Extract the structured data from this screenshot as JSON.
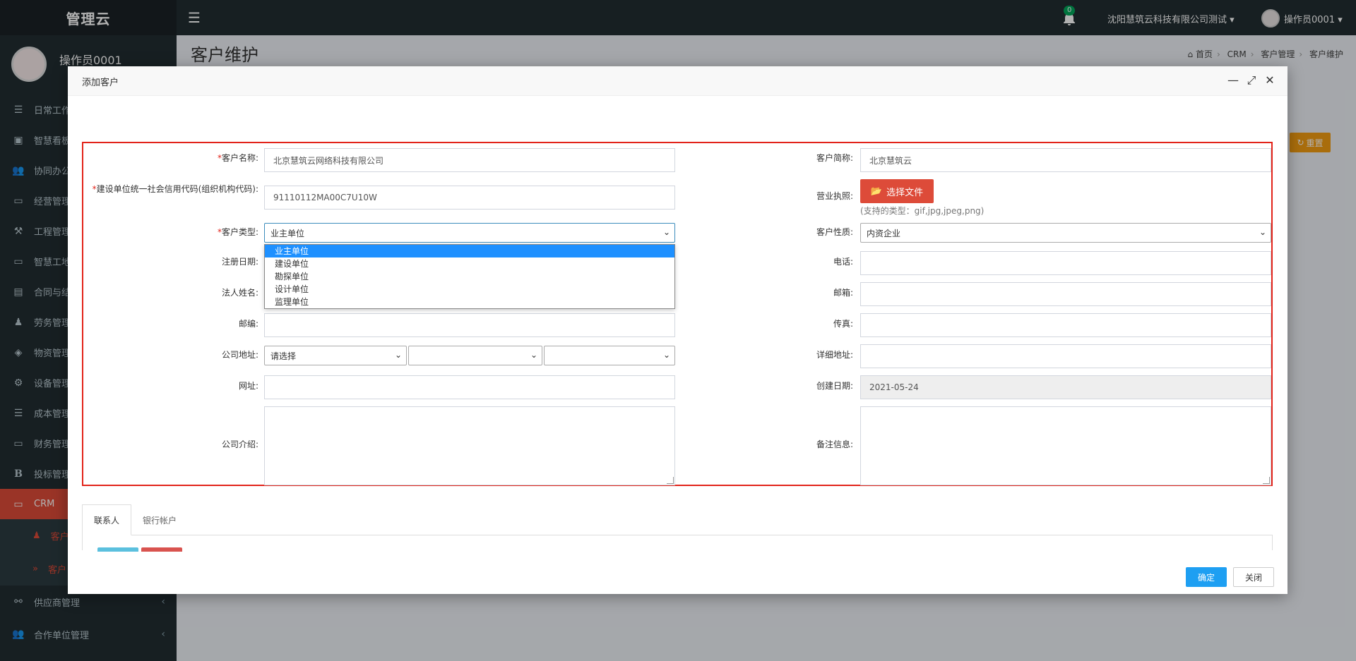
{
  "app": {
    "logo": "管理云",
    "notif_count": "0",
    "company": "沈阳慧筑云科技有限公司测试",
    "user": "操作员0001"
  },
  "sidebar": {
    "user_name": "操作员0001",
    "items": [
      {
        "label": "日常工作",
        "icon": "list-icon"
      },
      {
        "label": "智慧看板",
        "icon": "dashboard-icon"
      },
      {
        "label": "协同办公",
        "icon": "users-icon"
      },
      {
        "label": "经营管理",
        "icon": "monitor-icon"
      },
      {
        "label": "工程管理",
        "icon": "hammer-icon"
      },
      {
        "label": "智慧工地",
        "icon": "monitor-icon"
      },
      {
        "label": "合同与结算",
        "icon": "file-icon"
      },
      {
        "label": "劳务管理",
        "icon": "worker-icon"
      },
      {
        "label": "物资管理",
        "icon": "cube-icon"
      },
      {
        "label": "设备管理",
        "icon": "gears-icon"
      },
      {
        "label": "成本管理",
        "icon": "list-icon"
      },
      {
        "label": "财务管理",
        "icon": "monitor-icon"
      },
      {
        "label": "投标管理",
        "icon": "bold-icon"
      },
      {
        "label": "CRM",
        "icon": "monitor-icon",
        "active": true
      }
    ],
    "sub_items": [
      {
        "label": "客户"
      },
      {
        "label": "客户"
      }
    ],
    "bottom_items": [
      {
        "label": "供应商管理",
        "icon": "link-icon"
      },
      {
        "label": "合作单位管理",
        "icon": "users-icon"
      }
    ]
  },
  "header": {
    "title": "客户维护",
    "breadcrumb": [
      "首页",
      "CRM",
      "客户管理",
      "客户维护"
    ]
  },
  "background": {
    "reset_label": "重置"
  },
  "modal": {
    "title": "添加客户",
    "left": {
      "customer_name_label": "客户名称:",
      "customer_name_value": "北京慧筑云网络科技有限公司",
      "credit_code_label": "建设单位统一社会信用代码(组织机构代码):",
      "credit_code_value": "91110112MA00C7U10W",
      "customer_type_label": "客户类型:",
      "customer_type_value": "业主单位",
      "customer_type_options": [
        "业主单位",
        "建设单位",
        "勘探单位",
        "设计单位",
        "监理单位"
      ],
      "reg_date_label": "注册日期:",
      "legal_name_label": "法人姓名:",
      "postcode_label": "邮编:",
      "address_label": "公司地址:",
      "address_placeholder": "请选择",
      "website_label": "网址:",
      "intro_label": "公司介绍:"
    },
    "right": {
      "short_name_label": "客户简称:",
      "short_name_value": "北京慧筑云",
      "license_label": "营业执照:",
      "file_button": "选择文件",
      "file_hint": "(支持的类型：gif,jpg,jpeg,png)",
      "nature_label": "客户性质:",
      "nature_value": "内资企业",
      "phone_label": "电话:",
      "email_label": "邮箱:",
      "fax_label": "传真:",
      "detail_address_label": "详细地址:",
      "created_label": "创建日期:",
      "created_value": "2021-05-24",
      "remark_label": "备注信息:"
    },
    "tabs": [
      "联系人",
      "银行帐户"
    ],
    "ok_label": "确定",
    "close_label": "关闭"
  },
  "colors": {
    "accent_red": "#dd4b39",
    "primary_blue": "#1e9ff2",
    "highlight_border": "#e2231a"
  }
}
